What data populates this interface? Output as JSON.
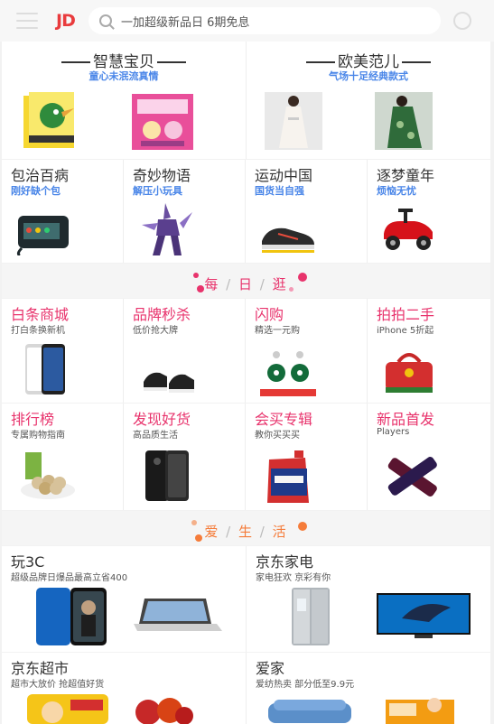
{
  "header": {
    "logo": "JD",
    "search_placeholder": "一加超级新品日 6期免息"
  },
  "top_banners": [
    {
      "title": "智慧宝贝",
      "subtitle": "童心未泯流真情"
    },
    {
      "title": "欧美范儿",
      "subtitle": "气场十足经典款式"
    }
  ],
  "mini_cells": [
    {
      "title": "包治百病",
      "subtitle": "刚好缺个包"
    },
    {
      "title": "奇妙物语",
      "subtitle": "解压小玩具"
    },
    {
      "title": "运动中国",
      "subtitle": "国货当自强"
    },
    {
      "title": "逐梦童年",
      "subtitle": "烦恼无忧"
    }
  ],
  "band_daily": {
    "chars": [
      "每",
      "日",
      "逛"
    ]
  },
  "daily_grid": [
    {
      "title": "白条商城",
      "subtitle": "打白条换新机"
    },
    {
      "title": "品牌秒杀",
      "subtitle": "低价抢大牌"
    },
    {
      "title": "闪购",
      "subtitle": "精选一元购"
    },
    {
      "title": "拍拍二手",
      "subtitle": "iPhone 5折起"
    },
    {
      "title": "排行榜",
      "subtitle": "专属购物指南"
    },
    {
      "title": "发现好货",
      "subtitle": "高品质生活"
    },
    {
      "title": "会买专辑",
      "subtitle": "教你买买买"
    },
    {
      "title": "新品首发",
      "subtitle": "Players"
    }
  ],
  "band_life": {
    "chars": [
      "爱",
      "生",
      "活"
    ]
  },
  "life_grid": [
    {
      "title": "玩3C",
      "subtitle": "超级品牌日爆品最高立省400"
    },
    {
      "title": "京东家电",
      "subtitle": "家电狂欢 京彩有你"
    },
    {
      "title": "京东超市",
      "subtitle": "超市大放价 抢超值好货"
    },
    {
      "title": "爱家",
      "subtitle": "爱纺热卖 部分低至9.9元"
    }
  ],
  "colors": {
    "accent": "#e93b3d",
    "pink": "#e8336c",
    "blue": "#4a86e8"
  }
}
